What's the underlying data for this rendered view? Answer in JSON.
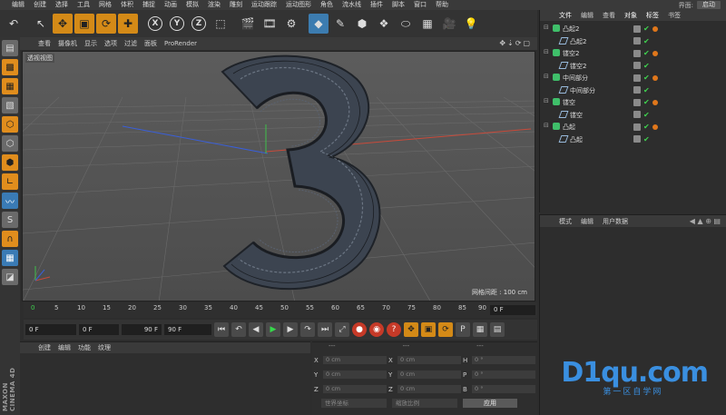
{
  "menubar": {
    "items": [
      "编辑",
      "创建",
      "选择",
      "工具",
      "网格",
      "体积",
      "捕捉",
      "动画",
      "模拟",
      "渲染",
      "雕刻",
      "运动跟踪",
      "运动图形",
      "角色",
      "流水线",
      "插件",
      "脚本",
      "窗口",
      "帮助"
    ],
    "layout_label": "界面:",
    "layout_value": "启动"
  },
  "toolbar": {
    "undo_icon": "undo-icon",
    "axis_x": "X",
    "axis_y": "Y",
    "axis_z": "Z"
  },
  "viewport": {
    "menu": [
      "查看",
      "摄像机",
      "显示",
      "选项",
      "过滤",
      "面板",
      "ProRender"
    ],
    "label": "透视视图",
    "grid_spacing": "网格间距 : 100 cm",
    "object_text": "3"
  },
  "timeline": {
    "ticks": [
      "0",
      "5",
      "10",
      "15",
      "20",
      "25",
      "30",
      "35",
      "40",
      "45",
      "50",
      "55",
      "60",
      "65",
      "70",
      "75",
      "80",
      "85",
      "90"
    ],
    "frame": "0 F"
  },
  "transport": {
    "start": "0 F",
    "range_start": "0 F",
    "range_end": "90 F",
    "end": "90 F"
  },
  "material_manager": {
    "menu": [
      "创建",
      "编辑",
      "功能",
      "纹理"
    ]
  },
  "coord_manager": {
    "headers": [
      "---",
      "---",
      "---"
    ],
    "rows": [
      {
        "a": "X",
        "v1": "0 cm",
        "b": "X",
        "v2": "0 cm",
        "c": "H",
        "v3": "0 °"
      },
      {
        "a": "Y",
        "v1": "0 cm",
        "b": "Y",
        "v2": "0 cm",
        "c": "P",
        "v3": "0 °"
      },
      {
        "a": "Z",
        "v1": "0 cm",
        "b": "Z",
        "v2": "0 cm",
        "c": "B",
        "v3": "0 °"
      }
    ],
    "world_dropdown": "世界坐标",
    "scale_dropdown": "缩放比例",
    "apply": "应用"
  },
  "object_manager": {
    "tabs": [
      "文件",
      "编辑",
      "查看",
      "对象",
      "标签",
      "书签"
    ],
    "objects": [
      {
        "name": "凸起2",
        "level": 0
      },
      {
        "name": "凸起2",
        "level": 1
      },
      {
        "name": "镂空2",
        "level": 0
      },
      {
        "name": "镂空2",
        "level": 1
      },
      {
        "name": "中间部分",
        "level": 0
      },
      {
        "name": "中间部分",
        "level": 1
      },
      {
        "name": "镂空",
        "level": 0
      },
      {
        "name": "镂空",
        "level": 1
      },
      {
        "name": "凸起",
        "level": 0
      },
      {
        "name": "凸起",
        "level": 1
      }
    ]
  },
  "attribute_manager": {
    "menu": [
      "模式",
      "编辑",
      "用户数据"
    ]
  },
  "brand": {
    "text": "MAXON CINEMA 4D"
  },
  "watermark": {
    "main": "D1qu.com",
    "sub": "第一区自学网"
  }
}
